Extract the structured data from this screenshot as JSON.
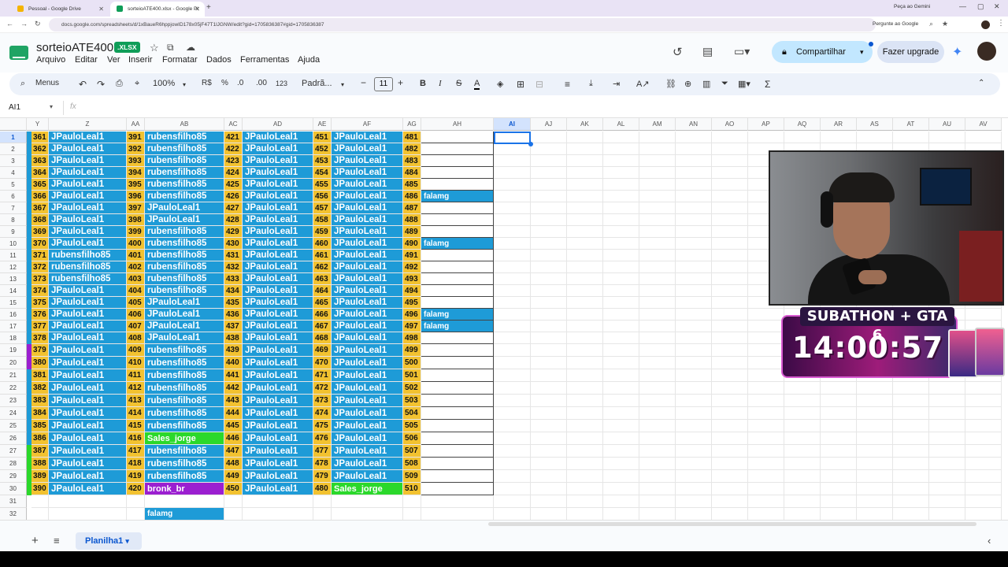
{
  "browser": {
    "tabs": [
      {
        "title": "Pessoal - Google Drive"
      },
      {
        "title": "sorteioATE400.xlsx - Google Pl"
      }
    ],
    "url": "docs.google.com/spreadsheets/d/1xBaueR6hppjowID178x05jF47T1lJGNW/edit?gid=1705836387#gid=1705836387",
    "gemini": "Pergunte ao Google",
    "gemini_mode": "Peça ao Gemini"
  },
  "doc": {
    "name": "sorteioATE400",
    "badge": ".XLSX"
  },
  "menu": [
    "Arquivo",
    "Editar",
    "Ver",
    "Inserir",
    "Formatar",
    "Dados",
    "Ferramentas",
    "Ajuda"
  ],
  "share_label": "Compartilhar",
  "upgrade_label": "Fazer upgrade",
  "toolbar": {
    "menus": "Menus",
    "zoom": "100%",
    "currency": "R$",
    "percent": "%",
    "dec_dec": ".0",
    "dec_inc": ".00",
    "format123": "123",
    "font": "Padrã...",
    "font_size": "11"
  },
  "name_box": "AI1",
  "columns": [
    "Y",
    "Z",
    "AA",
    "AB",
    "AC",
    "AD",
    "AE",
    "AF",
    "AG",
    "AH",
    "AI",
    "AJ",
    "AK",
    "AL",
    "AM",
    "AN",
    "AO",
    "AP",
    "AQ",
    "AR",
    "AS",
    "AT",
    "AU",
    "AV"
  ],
  "rows": [
    {
      "n": "1",
      "c": [
        "361",
        "JPauloLeal1",
        "391",
        "rubensfilho85",
        "421",
        "JPauloLeal1",
        "451",
        "JPauloLeal1",
        "481",
        ""
      ]
    },
    {
      "n": "2",
      "c": [
        "362",
        "JPauloLeal1",
        "392",
        "rubensfilho85",
        "422",
        "JPauloLeal1",
        "452",
        "JPauloLeal1",
        "482",
        ""
      ]
    },
    {
      "n": "3",
      "c": [
        "363",
        "JPauloLeal1",
        "393",
        "rubensfilho85",
        "423",
        "JPauloLeal1",
        "453",
        "JPauloLeal1",
        "483",
        ""
      ]
    },
    {
      "n": "4",
      "c": [
        "364",
        "JPauloLeal1",
        "394",
        "rubensfilho85",
        "424",
        "JPauloLeal1",
        "454",
        "JPauloLeal1",
        "484",
        ""
      ]
    },
    {
      "n": "5",
      "c": [
        "365",
        "JPauloLeal1",
        "395",
        "rubensfilho85",
        "425",
        "JPauloLeal1",
        "455",
        "JPauloLeal1",
        "485",
        ""
      ]
    },
    {
      "n": "6",
      "c": [
        "366",
        "JPauloLeal1",
        "396",
        "rubensfilho85",
        "426",
        "JPauloLeal1",
        "456",
        "JPauloLeal1",
        "486",
        "falamg"
      ]
    },
    {
      "n": "7",
      "c": [
        "367",
        "JPauloLeal1",
        "397",
        "JPauloLeal1",
        "427",
        "JPauloLeal1",
        "457",
        "JPauloLeal1",
        "487",
        ""
      ]
    },
    {
      "n": "8",
      "c": [
        "368",
        "JPauloLeal1",
        "398",
        "JPauloLeal1",
        "428",
        "JPauloLeal1",
        "458",
        "JPauloLeal1",
        "488",
        ""
      ]
    },
    {
      "n": "9",
      "c": [
        "369",
        "JPauloLeal1",
        "399",
        "rubensfilho85",
        "429",
        "JPauloLeal1",
        "459",
        "JPauloLeal1",
        "489",
        ""
      ]
    },
    {
      "n": "10",
      "c": [
        "370",
        "JPauloLeal1",
        "400",
        "rubensfilho85",
        "430",
        "JPauloLeal1",
        "460",
        "JPauloLeal1",
        "490",
        "falamg"
      ]
    },
    {
      "n": "11",
      "c": [
        "371",
        "rubensfilho85",
        "401",
        "rubensfilho85",
        "431",
        "JPauloLeal1",
        "461",
        "JPauloLeal1",
        "491",
        ""
      ]
    },
    {
      "n": "12",
      "c": [
        "372",
        "rubensfilho85",
        "402",
        "rubensfilho85",
        "432",
        "JPauloLeal1",
        "462",
        "JPauloLeal1",
        "492",
        ""
      ]
    },
    {
      "n": "13",
      "c": [
        "373",
        "rubensfilho85",
        "403",
        "rubensfilho85",
        "433",
        "JPauloLeal1",
        "463",
        "JPauloLeal1",
        "493",
        ""
      ]
    },
    {
      "n": "14",
      "c": [
        "374",
        "JPauloLeal1",
        "404",
        "rubensfilho85",
        "434",
        "JPauloLeal1",
        "464",
        "JPauloLeal1",
        "494",
        ""
      ]
    },
    {
      "n": "15",
      "c": [
        "375",
        "JPauloLeal1",
        "405",
        "JPauloLeal1",
        "435",
        "JPauloLeal1",
        "465",
        "JPauloLeal1",
        "495",
        ""
      ]
    },
    {
      "n": "16",
      "c": [
        "376",
        "JPauloLeal1",
        "406",
        "JPauloLeal1",
        "436",
        "JPauloLeal1",
        "466",
        "JPauloLeal1",
        "496",
        "falamg"
      ]
    },
    {
      "n": "17",
      "c": [
        "377",
        "JPauloLeal1",
        "407",
        "JPauloLeal1",
        "437",
        "JPauloLeal1",
        "467",
        "JPauloLeal1",
        "497",
        "falamg"
      ]
    },
    {
      "n": "18",
      "c": [
        "378",
        "JPauloLeal1",
        "408",
        "JPauloLeal1",
        "438",
        "JPauloLeal1",
        "468",
        "JPauloLeal1",
        "498",
        ""
      ]
    },
    {
      "n": "19",
      "c": [
        "379",
        "JPauloLeal1",
        "409",
        "rubensfilho85",
        "439",
        "JPauloLeal1",
        "469",
        "JPauloLeal1",
        "499",
        ""
      ]
    },
    {
      "n": "20",
      "c": [
        "380",
        "JPauloLeal1",
        "410",
        "rubensfilho85",
        "440",
        "JPauloLeal1",
        "470",
        "JPauloLeal1",
        "500",
        ""
      ]
    },
    {
      "n": "21",
      "c": [
        "381",
        "JPauloLeal1",
        "411",
        "rubensfilho85",
        "441",
        "JPauloLeal1",
        "471",
        "JPauloLeal1",
        "501",
        ""
      ]
    },
    {
      "n": "22",
      "c": [
        "382",
        "JPauloLeal1",
        "412",
        "rubensfilho85",
        "442",
        "JPauloLeal1",
        "472",
        "JPauloLeal1",
        "502",
        ""
      ]
    },
    {
      "n": "23",
      "c": [
        "383",
        "JPauloLeal1",
        "413",
        "rubensfilho85",
        "443",
        "JPauloLeal1",
        "473",
        "JPauloLeal1",
        "503",
        ""
      ]
    },
    {
      "n": "24",
      "c": [
        "384",
        "JPauloLeal1",
        "414",
        "rubensfilho85",
        "444",
        "JPauloLeal1",
        "474",
        "JPauloLeal1",
        "504",
        ""
      ]
    },
    {
      "n": "25",
      "c": [
        "385",
        "JPauloLeal1",
        "415",
        "rubensfilho85",
        "445",
        "JPauloLeal1",
        "475",
        "JPauloLeal1",
        "505",
        ""
      ]
    },
    {
      "n": "26",
      "c": [
        "386",
        "JPauloLeal1",
        "416",
        "Sales_jorge",
        "446",
        "JPauloLeal1",
        "476",
        "JPauloLeal1",
        "506",
        ""
      ]
    },
    {
      "n": "27",
      "c": [
        "387",
        "JPauloLeal1",
        "417",
        "rubensfilho85",
        "447",
        "JPauloLeal1",
        "477",
        "JPauloLeal1",
        "507",
        ""
      ]
    },
    {
      "n": "28",
      "c": [
        "388",
        "JPauloLeal1",
        "418",
        "rubensfilho85",
        "448",
        "JPauloLeal1",
        "478",
        "JPauloLeal1",
        "508",
        ""
      ]
    },
    {
      "n": "29",
      "c": [
        "389",
        "JPauloLeal1",
        "419",
        "rubensfilho85",
        "449",
        "JPauloLeal1",
        "479",
        "JPauloLeal1",
        "509",
        ""
      ]
    },
    {
      "n": "30",
      "c": [
        "390",
        "JPauloLeal1",
        "420",
        "bronk_br",
        "450",
        "JPauloLeal1",
        "480",
        "Sales_jorge",
        "510",
        ""
      ]
    },
    {
      "n": "31",
      "c": [
        "",
        "",
        "",
        "",
        "",
        "",
        "",
        "",
        "",
        ""
      ]
    },
    {
      "n": "32",
      "c": [
        "",
        "",
        "",
        "falamg",
        "",
        "",
        "",
        "",
        "",
        ""
      ]
    }
  ],
  "overlay": {
    "title": "SUBATHON + GTA 6",
    "timer": "14:00:57"
  },
  "sheet_tab": "Planilha1",
  "colors": {
    "blue": "#1e9bd7",
    "gold": "#f2c230",
    "green": "#2bd82b",
    "purple": "#9b1fd0"
  }
}
